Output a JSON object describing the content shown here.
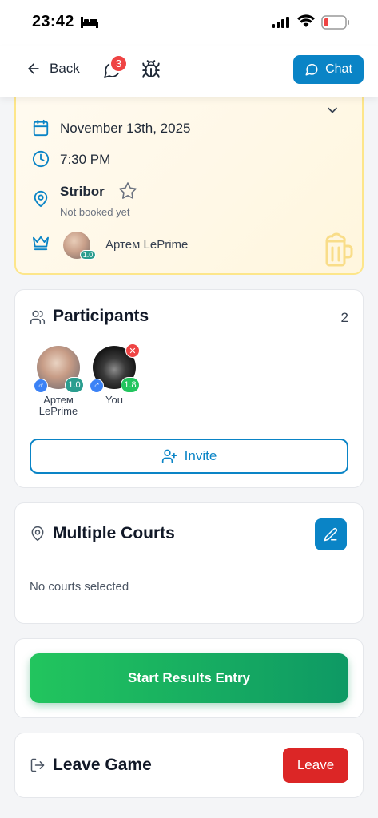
{
  "status_bar": {
    "time": "23:42"
  },
  "header": {
    "back_label": "Back",
    "messages_badge": "3",
    "chat_label": "Chat"
  },
  "game": {
    "date": "November 13th, 2025",
    "time": "7:30 PM",
    "venue": "Stribor",
    "booking_status": "Not booked yet",
    "owner": {
      "name": "Артем LePrime",
      "level": "1.0"
    }
  },
  "participants": {
    "title": "Participants",
    "count": "2",
    "list": [
      {
        "name": "Артем LePrime",
        "level": "1.0",
        "gender": "♂"
      },
      {
        "name": "You",
        "level": "1.8",
        "gender": "♂"
      }
    ],
    "invite_label": "Invite"
  },
  "courts": {
    "title": "Multiple Courts",
    "empty_text": "No courts selected"
  },
  "results": {
    "button_label": "Start Results Entry"
  },
  "leave": {
    "title": "Leave Game",
    "button_label": "Leave"
  },
  "colors": {
    "accent": "#0a84c6",
    "danger": "#dc2626",
    "success_start": "#22c55e",
    "success_end": "#0e9964",
    "highlight_border": "#fde68a"
  },
  "icons": {
    "back": "arrow-left-icon",
    "messages": "message-circle-icon",
    "bug": "bug-icon",
    "chat": "message-circle-icon",
    "date": "calendar-icon",
    "time": "clock-icon",
    "venue": "map-pin-icon",
    "favorite": "star-icon",
    "owner": "crown-icon",
    "decor": "beer-mug-icon",
    "participants": "users-icon",
    "invite": "user-plus-icon",
    "courts": "map-pin-icon",
    "edit": "pencil-icon",
    "leave": "log-out-icon"
  }
}
